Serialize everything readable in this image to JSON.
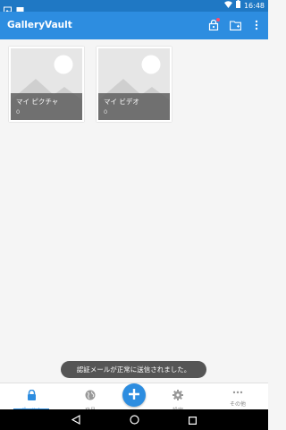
{
  "status_bar": {
    "time": "16:48",
    "icons": [
      "gallery-notification-icon",
      "image-notification-icon",
      "wifi-icon",
      "battery-icon"
    ]
  },
  "app_bar": {
    "title": "GalleryVault",
    "actions": [
      "private-lock-icon",
      "new-folder-icon",
      "more-vert-icon"
    ],
    "accent": "#2d8de0"
  },
  "albums": [
    {
      "name": "マイ ピクチャ",
      "count": "0"
    },
    {
      "name": "マイ ビデオ",
      "count": "0"
    }
  ],
  "toast": {
    "message": "認証メールが正常に送信されました。"
  },
  "bottom_nav": {
    "items": [
      {
        "label": "ポールト",
        "icon": "lock-icon",
        "active": true
      },
      {
        "label": "発見",
        "icon": "globe-icon",
        "active": false
      },
      {
        "label": "",
        "icon": "add-icon",
        "active": false
      },
      {
        "label": "設定",
        "icon": "gear-icon",
        "active": false
      },
      {
        "label": "その他",
        "icon": "more-horiz-icon",
        "active": false
      }
    ]
  },
  "system_nav": [
    "back-icon",
    "home-icon",
    "recents-icon"
  ]
}
